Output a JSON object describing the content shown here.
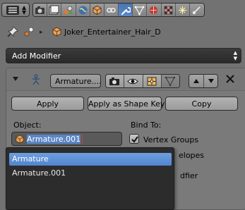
{
  "header": {
    "editor_type_icon": "properties-editor-icon",
    "tabs": [
      {
        "icon": "render-icon",
        "active": false
      },
      {
        "icon": "render-layers-icon",
        "active": false
      },
      {
        "icon": "scene-icon",
        "active": false
      },
      {
        "icon": "world-icon",
        "active": false
      },
      {
        "icon": "object-icon",
        "active": false
      },
      {
        "icon": "constraints-icon",
        "active": false
      },
      {
        "icon": "modifiers-wrench-icon",
        "active": true
      },
      {
        "icon": "data-icon",
        "active": false
      },
      {
        "icon": "material-icon",
        "active": false
      },
      {
        "icon": "texture-icon",
        "active": false
      },
      {
        "icon": "particles-icon",
        "active": false
      },
      {
        "icon": "physics-icon",
        "active": false
      }
    ]
  },
  "context": {
    "object_name": "Joker_Entertainer_Hair_D"
  },
  "add_modifier": {
    "label": "Add Modifier"
  },
  "modifier": {
    "name": "Armature....",
    "apply_label": "Apply",
    "apply_shape_label": "Apply as Shape Key",
    "copy_label": "Copy",
    "object_label": "Object:",
    "object_value_selected": "Armature.001",
    "bind_to_label": "Bind To:",
    "vertex_groups_label": "Vertex Groups",
    "bone_envelopes_partial": "elopes",
    "preserve_partial": "dfier",
    "vertex_groups_checked": true
  },
  "dropdown": {
    "options": [
      "Armature",
      "Armature.001"
    ],
    "highlighted_index": 0
  },
  "colors": {
    "background": "#727272",
    "active_tab": "#5b88c6",
    "selection": "#5b85c6",
    "dropdown_bg": "#2c2c2c",
    "highlight": "#5185cf"
  }
}
